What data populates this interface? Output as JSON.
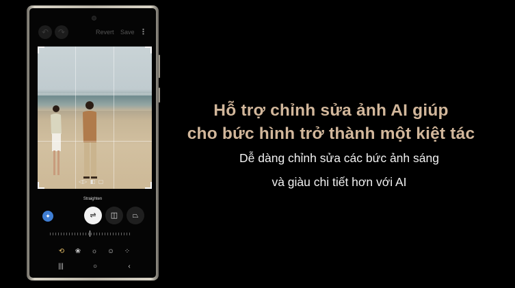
{
  "editor": {
    "undo_icon": "undo-icon",
    "redo_icon": "redo-icon",
    "revert_label": "Revert",
    "save_label": "Save",
    "more_icon": "more-vertical-icon",
    "straighten_label": "Straighten",
    "tools": [
      "auto-enhance-icon",
      "straighten-icon",
      "vertical-perspective-icon",
      "horizontal-perspective-icon"
    ],
    "active_tool": "straighten-icon",
    "bottom_tools": [
      "transform-icon",
      "filters-icon",
      "adjust-brightness-icon",
      "stickers-icon",
      "more-tools-icon"
    ],
    "active_bottom_tool": "transform-icon",
    "nav": [
      "recents-icon",
      "home-icon",
      "back-icon"
    ],
    "accent": "#3f7ed4",
    "highlight": "#e8c069"
  },
  "promo": {
    "headline_line1": "Hỗ trợ chỉnh sửa ảnh AI giúp",
    "headline_line2": "cho bức hình trở thành một kiệt tác",
    "sub_line1": "Dễ dàng chỉnh sửa các bức ảnh sáng",
    "sub_line2": "và giàu chi tiết hơn với AI",
    "headline_color": "#d2b79b",
    "sub_color": "#f1f1f1"
  }
}
